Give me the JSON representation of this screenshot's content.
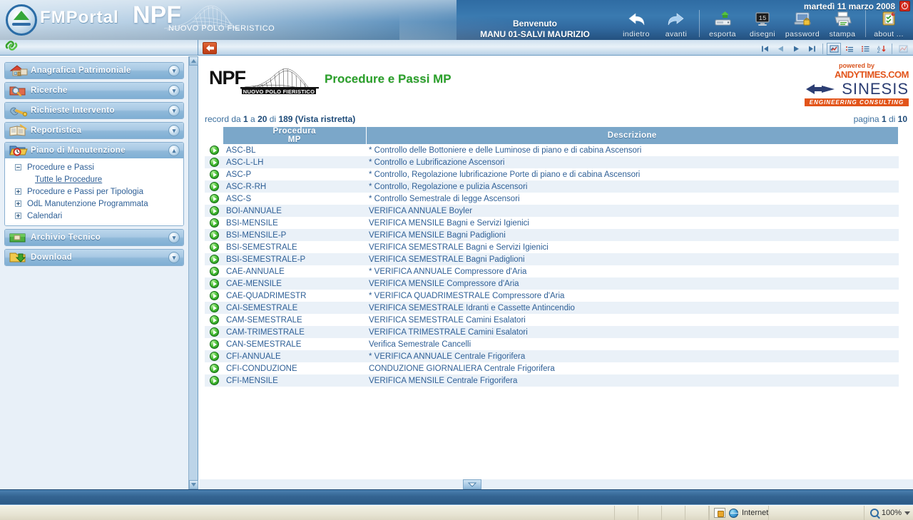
{
  "banner": {
    "brand_fmportal": "FMPortal",
    "brand_npf": "NPF",
    "brand_sub": "NUOVO POLO FIERISTICO",
    "welcome_label": "Benvenuto",
    "user_name": "MANU 01-SALVI MAURIZIO",
    "date": "martedì 11 marzo 2008",
    "power_icon": "power-icon",
    "toolbar": [
      {
        "label": "indietro",
        "icon": "back-arrow-icon"
      },
      {
        "label": "avanti",
        "icon": "forward-arrow-icon"
      },
      {
        "label": "esporta",
        "icon": "export-disk-icon"
      },
      {
        "label": "disegni",
        "icon": "drawings-monitor-icon"
      },
      {
        "label": "password",
        "icon": "password-lock-icon"
      },
      {
        "label": "stampa",
        "icon": "printer-icon"
      },
      {
        "label": "about ...",
        "icon": "about-clipboard-icon"
      }
    ]
  },
  "substrip": {
    "link_icon": "green-link-icon",
    "back_button_icon": "back-red-arrow-icon",
    "nav": [
      {
        "name": "first-record",
        "glyph": "|◀"
      },
      {
        "name": "previous-record",
        "glyph": "◀"
      },
      {
        "name": "next-record",
        "glyph": "▶"
      },
      {
        "name": "last-record",
        "glyph": "▶|"
      }
    ],
    "tools": [
      {
        "name": "check-grid-icon"
      },
      {
        "name": "totals-icon"
      },
      {
        "name": "list-icon"
      },
      {
        "name": "sort-az-icon"
      },
      {
        "name": "chart-icon-disabled"
      }
    ]
  },
  "sidebar": {
    "panels": [
      {
        "id": "anagrafica-patrimoniale",
        "title": "Anagrafica Patrimoniale",
        "icon": "house-icon",
        "expanded": false,
        "toggle": "«"
      },
      {
        "id": "ricerche",
        "title": "Ricerche",
        "icon": "magnifier-folder-icon",
        "expanded": false,
        "toggle": "«"
      },
      {
        "id": "richieste-intervento",
        "title": "Richieste Intervento",
        "icon": "wrench-icon",
        "expanded": false,
        "toggle": "«"
      },
      {
        "id": "reportistica",
        "title": "Reportistica",
        "icon": "report-book-icon",
        "expanded": false,
        "toggle": "«"
      },
      {
        "id": "piano-di-manutenzione",
        "title": "Piano di Manutenzione",
        "icon": "folder-clock-icon",
        "expanded": true,
        "toggle": "»",
        "items": [
          {
            "label": "Procedure e Passi",
            "state": "minus"
          },
          {
            "label": "Tutte le Procedure",
            "state": "leaf-selected"
          },
          {
            "label": "Procedure e Passi per Tipologia",
            "state": "plus"
          },
          {
            "label": "OdL Manutenzione Programmata",
            "state": "plus"
          },
          {
            "label": "Calendari",
            "state": "plus"
          }
        ]
      },
      {
        "id": "archivio-tecnico",
        "title": "Archivio Tecnico",
        "icon": "green-folder-icon",
        "expanded": false,
        "toggle": "«"
      },
      {
        "id": "download",
        "title": "Download",
        "icon": "download-folder-icon",
        "expanded": false,
        "toggle": "«"
      }
    ]
  },
  "main": {
    "logo_text": "NPF",
    "logo_sub": "NUOVO POLO FIERISTICO",
    "page_title": "Procedure e Passi MP",
    "sinesis": {
      "powered_by": "powered by",
      "andytimes": "ANDYTIMES.COM",
      "name": "SINESIS",
      "tagline": "ENGINEERING CONSULTING"
    },
    "record_info_prefix": "record da ",
    "record_from": "1",
    "record_mid": " a ",
    "record_to": "20",
    "record_of": " di ",
    "record_total": "189",
    "record_suffix": " (Vista ristretta)",
    "page_info_prefix": "pagina ",
    "page_current": "1",
    "page_mid": " di ",
    "page_total": "10",
    "columns": {
      "go": "",
      "procedura": "Procedura\nMP",
      "procedura_line1": "Procedura",
      "procedura_line2": "MP",
      "descrizione": "Descrizione"
    },
    "rows": [
      {
        "procedura": "ASC-BL",
        "descrizione": "* Controllo delle Bottoniere e delle Luminose di piano e di cabina Ascensori"
      },
      {
        "procedura": "ASC-L-LH",
        "descrizione": "* Controllo e Lubrificazione Ascensori"
      },
      {
        "procedura": "ASC-P",
        "descrizione": "* Controllo, Regolazione lubrificazione Porte di piano e di cabina Ascensori"
      },
      {
        "procedura": "ASC-R-RH",
        "descrizione": "* Controllo, Regolazione e pulizia Ascensori"
      },
      {
        "procedura": "ASC-S",
        "descrizione": "* Controllo Semestrale di legge Ascensori"
      },
      {
        "procedura": "BOI-ANNUALE",
        "descrizione": "VERIFICA ANNUALE Boyler"
      },
      {
        "procedura": "BSI-MENSILE",
        "descrizione": "VERIFICA MENSILE Bagni e Servizi Igienici"
      },
      {
        "procedura": "BSI-MENSILE-P",
        "descrizione": "VERIFICA MENSILE Bagni Padiglioni"
      },
      {
        "procedura": "BSI-SEMESTRALE",
        "descrizione": "VERIFICA SEMESTRALE Bagni e Servizi Igienici"
      },
      {
        "procedura": "BSI-SEMESTRALE-P",
        "descrizione": "VERIFICA SEMESTRALE Bagni Padiglioni"
      },
      {
        "procedura": "CAE-ANNUALE",
        "descrizione": "* VERIFICA ANNUALE Compressore d'Aria"
      },
      {
        "procedura": "CAE-MENSILE",
        "descrizione": "VERIFICA MENSILE Compressore d'Aria"
      },
      {
        "procedura": "CAE-QUADRIMESTR",
        "descrizione": "* VERIFICA QUADRIMESTRALE Compressore d'Aria"
      },
      {
        "procedura": "CAI-SEMESTRALE",
        "descrizione": "VERIFICA SEMESTRALE Idranti e Cassette Antincendio"
      },
      {
        "procedura": "CAM-SEMESTRALE",
        "descrizione": "VERIFICA SEMESTRALE Camini Esalatori"
      },
      {
        "procedura": "CAM-TRIMESTRALE",
        "descrizione": "VERIFICA TRIMESTRALE Camini Esalatori"
      },
      {
        "procedura": "CAN-SEMESTRALE",
        "descrizione": "Verifica Semestrale Cancelli"
      },
      {
        "procedura": "CFI-ANNUALE",
        "descrizione": "* VERIFICA ANNUALE Centrale Frigorifera"
      },
      {
        "procedura": "CFI-CONDUZIONE",
        "descrizione": "CONDUZIONE GIORNALIERA Centrale Frigorifera"
      },
      {
        "procedura": "CFI-MENSILE",
        "descrizione": "VERIFICA MENSILE Centrale Frigorifera"
      }
    ]
  },
  "statusbar": {
    "zone": "Internet",
    "zone_icon": "internet-globe-icon",
    "security_icon": "security-lock-icon",
    "zoom": "100%",
    "zoom_icon": "zoom-magnifier-icon"
  },
  "colors": {
    "banner_blue": "#2f6ca3",
    "title_green": "#2aa02a",
    "table_header": "#7ba7c9",
    "row_alt": "#eaf1f8",
    "link_blue": "#2e5f96",
    "accent_orange": "#e2541a"
  }
}
